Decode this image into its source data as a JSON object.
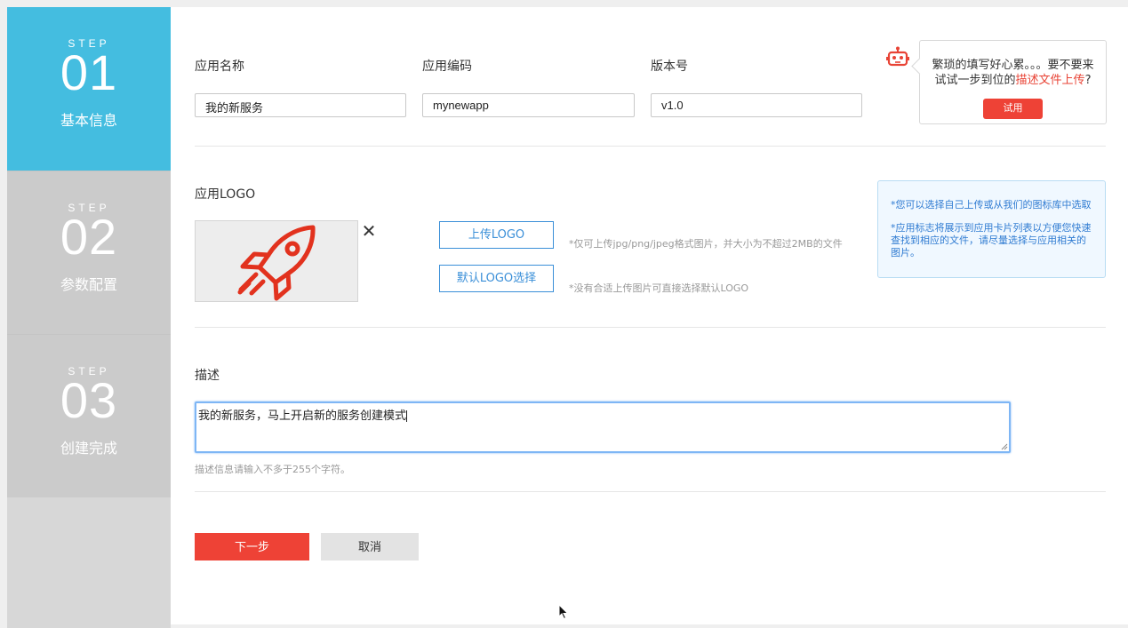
{
  "steps": [
    {
      "label": "STEP",
      "num": "01",
      "name": "基本信息",
      "active": true
    },
    {
      "label": "STEP",
      "num": "02",
      "name": "参数配置",
      "active": false
    },
    {
      "label": "STEP",
      "num": "03",
      "name": "创建完成",
      "active": false
    }
  ],
  "form": {
    "app_name_label": "应用名称",
    "app_name_value": "我的新服务",
    "app_code_label": "应用编码",
    "app_code_value": "mynewapp",
    "version_label": "版本号",
    "version_value": "v1.0",
    "logo_label": "应用LOGO",
    "upload_logo": "上传LOGO",
    "upload_hint": "*仅可上传jpg/png/jpeg格式图片，并大小为不超过2MB的文件",
    "default_logo": "默认LOGO选择",
    "default_hint": "*没有合适上传图片可直接选择默认LOGO",
    "close_glyph": "✕",
    "desc_label": "描述",
    "desc_value": "我的新服务，马上开启新的服务创建模式",
    "desc_hint": "描述信息请输入不多于255个字符。",
    "next": "下一步",
    "cancel": "取消"
  },
  "tip": {
    "line1": "繁琐的填写好心累。。。要不要来",
    "line2_prefix": "试试一步到位的",
    "line2_link": "描述文件上传",
    "line2_suffix": "?",
    "try": "试用"
  },
  "info": {
    "p1": "*您可以选择自己上传或从我们的图标库中选取",
    "p2": "*应用标志将展示到应用卡片列表以方便您快速查找到相应的文件，请尽量选择与应用相关的图片。"
  },
  "colors": {
    "active_step": "#44bde0",
    "accent_red": "#ee4236",
    "link_blue": "#3a8fd8"
  },
  "icons": [
    "robot-icon",
    "rocket-icon",
    "close-icon",
    "mouse-cursor-icon"
  ]
}
